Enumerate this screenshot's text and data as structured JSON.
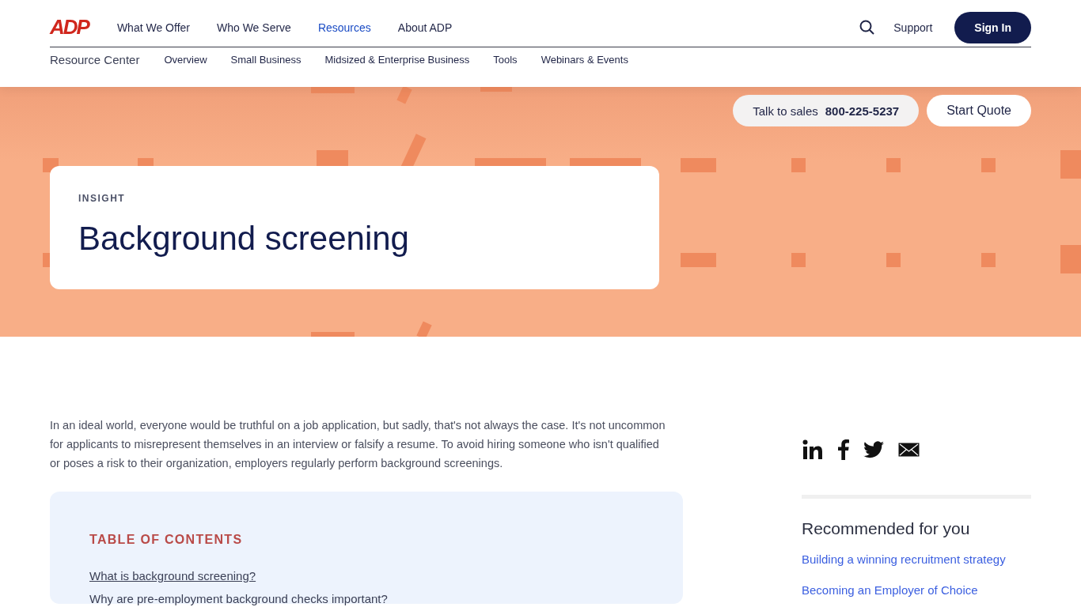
{
  "header": {
    "logo": "ADP",
    "nav": [
      {
        "label": "What We Offer",
        "selected": false
      },
      {
        "label": "Who We Serve",
        "selected": false
      },
      {
        "label": "Resources",
        "selected": true
      },
      {
        "label": "About ADP",
        "selected": false
      }
    ],
    "support": "Support",
    "sign_in": "Sign In"
  },
  "subnav": {
    "title": "Resource Center",
    "items": [
      "Overview",
      "Small Business",
      "Midsized & Enterprise Business",
      "Tools",
      "Webinars & Events"
    ]
  },
  "hero": {
    "sales_label": "Talk to sales",
    "sales_phone": "800-225-5237",
    "quote": "Start Quote",
    "eyebrow": "INSIGHT",
    "title": "Background screening"
  },
  "article": {
    "intro": "In an ideal world, everyone would be truthful on a job application, but sadly, that's not always the case. It's not uncommon for applicants to misrepresent themselves in an interview or falsify a resume. To avoid hiring someone who isn't qualified or poses a risk to their organization, employers regularly perform background screenings.",
    "toc": {
      "title": "TABLE OF CONTENTS",
      "items": [
        {
          "label": "What is background screening?",
          "underlined": true
        },
        {
          "label": "Why are pre-employment background checks important?",
          "underlined": false
        }
      ]
    }
  },
  "sidebar": {
    "share": [
      {
        "kind": "linkedin"
      },
      {
        "kind": "facebook"
      },
      {
        "kind": "twitter"
      },
      {
        "kind": "email"
      }
    ],
    "recommended_title": "Recommended for you",
    "links": [
      "Building a winning recruitment strategy",
      "Becoming an Employer of Choice"
    ]
  }
}
